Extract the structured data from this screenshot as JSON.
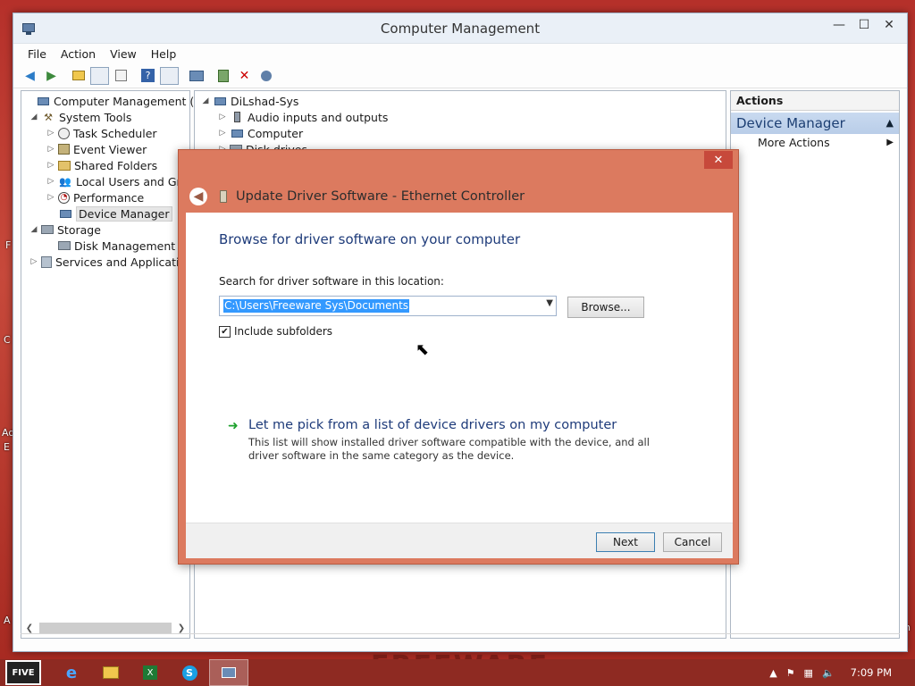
{
  "desktop": {
    "frag1": "F",
    "frag2": "C",
    "frag3": "Ad",
    "frag4": "E",
    "frag5": "A",
    "frag6": "n",
    "watermark": "FREEWARE"
  },
  "window": {
    "title": "Computer Management",
    "controls": {
      "minimize": "—",
      "maximize": "☐",
      "close": "✕"
    },
    "menu": [
      "File",
      "Action",
      "View",
      "Help"
    ]
  },
  "left_tree": [
    {
      "label": "Computer Management (Local",
      "level": 0,
      "twisty": "",
      "icon": "monitor-icon"
    },
    {
      "label": "System Tools",
      "level": 1,
      "twisty": "◢",
      "icon": "tools-icon"
    },
    {
      "label": "Task Scheduler",
      "level": 2,
      "twisty": "▷",
      "icon": "clock-icon"
    },
    {
      "label": "Event Viewer",
      "level": 2,
      "twisty": "▷",
      "icon": "event-icon"
    },
    {
      "label": "Shared Folders",
      "level": 2,
      "twisty": "▷",
      "icon": "folder-icon"
    },
    {
      "label": "Local Users and Group",
      "level": 2,
      "twisty": "▷",
      "icon": "users-icon"
    },
    {
      "label": "Performance",
      "level": 2,
      "twisty": "▷",
      "icon": "performance-icon"
    },
    {
      "label": "Device Manager",
      "level": 2,
      "twisty": "",
      "icon": "monitor-icon",
      "selected": true
    },
    {
      "label": "Storage",
      "level": 1,
      "twisty": "◢",
      "icon": "storage-icon"
    },
    {
      "label": "Disk Management",
      "level": 2,
      "twisty": "",
      "icon": "disk-icon"
    },
    {
      "label": "Services and Applications",
      "level": 1,
      "twisty": "▷",
      "icon": "services-icon"
    }
  ],
  "mid_tree": [
    {
      "label": "DiLshad-Sys",
      "level": 0,
      "twisty": "◢",
      "icon": "monitor-icon"
    },
    {
      "label": "Audio inputs and outputs",
      "level": 1,
      "twisty": "▷",
      "icon": "audio-icon"
    },
    {
      "label": "Computer",
      "level": 1,
      "twisty": "▷",
      "icon": "monitor-icon"
    },
    {
      "label": "Disk drives",
      "level": 1,
      "twisty": "▷",
      "icon": "disk-icon"
    }
  ],
  "actions": {
    "header": "Actions",
    "section": "Device Manager",
    "more": "More Actions"
  },
  "dialog": {
    "title": "Update Driver Software - Ethernet Controller",
    "main_instruction": "Browse for driver software on your computer",
    "search_label": "Search for driver software in this location:",
    "path_value": "C:\\Users\\Freeware Sys\\Documents",
    "browse_label": "Browse...",
    "include_subfolders_label": "Include subfolders",
    "include_subfolders_checked": true,
    "pick_link": "Let me pick from a list of device drivers on my computer",
    "pick_desc": "This list will show installed driver software compatible with the device, and all driver software in the same category as the device.",
    "next_label": "Next",
    "cancel_label": "Cancel"
  },
  "taskbar": {
    "gta_label": "FIVE",
    "excel_glyph": "X",
    "skype_glyph": "S",
    "clock": "7:09 PM"
  }
}
